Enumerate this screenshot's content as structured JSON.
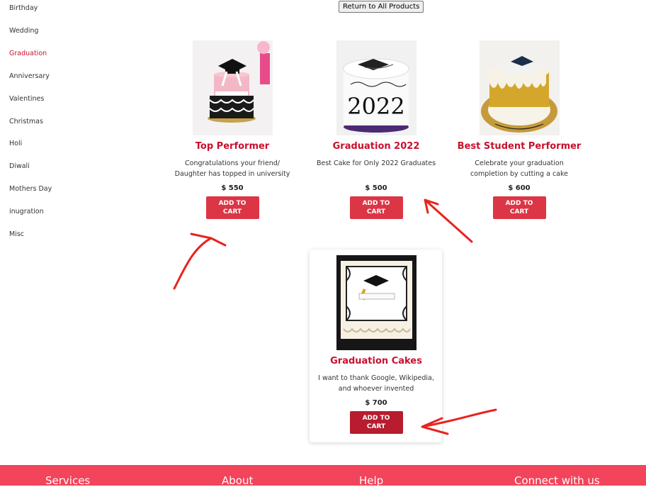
{
  "sidebar": {
    "items": [
      {
        "label": "Birthday"
      },
      {
        "label": "Wedding"
      },
      {
        "label": "Graduation",
        "active": true
      },
      {
        "label": "Anniversary"
      },
      {
        "label": "Valentines"
      },
      {
        "label": "Christmas"
      },
      {
        "label": "Holi"
      },
      {
        "label": "Diwali"
      },
      {
        "label": "Mothers Day"
      },
      {
        "label": "inugration"
      },
      {
        "label": "Misc"
      }
    ]
  },
  "return_button": "Return to All Products",
  "products": [
    {
      "title": "Top Performer",
      "desc": "Congratulations your friend/ Daughter has topped in university",
      "price": "$ 550",
      "button": "ADD TO CART"
    },
    {
      "title": "Graduation 2022",
      "desc": "Best Cake for Only 2022 Graduates",
      "price": "$ 500",
      "button": "ADD TO CART",
      "cake_text": "2022"
    },
    {
      "title": "Best Student Performer",
      "desc": "Celebrate your graduation completion by cutting a cake",
      "price": "$ 600",
      "button": "ADD TO CART"
    },
    {
      "title": "Graduation Cakes",
      "desc": "I want to thank Google, Wikipedia, and whoever invented",
      "price": "$ 700",
      "button": "ADD TO CART"
    }
  ],
  "footer": {
    "links": [
      "Services",
      "About",
      "Help",
      "Connect with us"
    ]
  },
  "colors": {
    "accent": "#c8102e",
    "button": "#dc3545",
    "footer": "#f2445a",
    "annotation": "#e8231f"
  }
}
